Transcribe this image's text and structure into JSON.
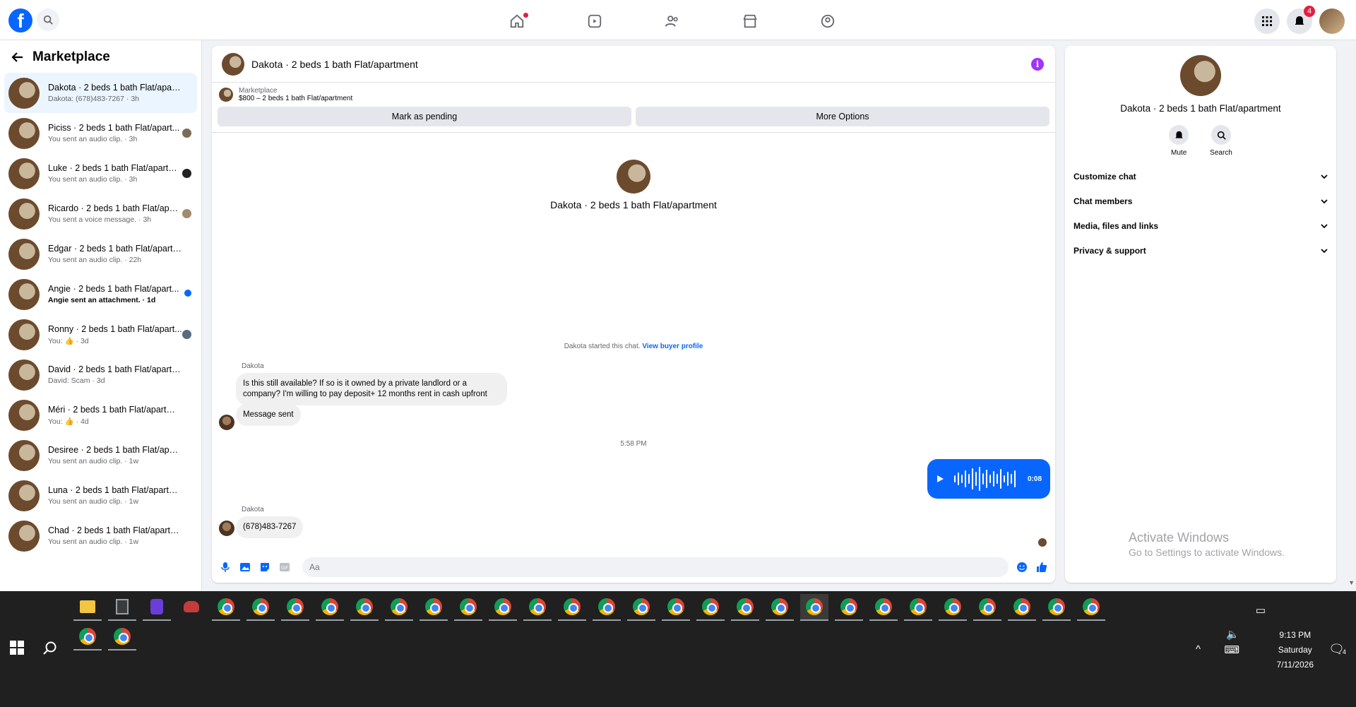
{
  "topbar": {
    "logo": "f",
    "nav": [
      "home-icon",
      "video-icon",
      "friends-icon",
      "marketplace-icon",
      "groups-icon"
    ],
    "notifications_count": "4"
  },
  "sidebar": {
    "title": "Marketplace",
    "conversations": [
      {
        "name": "Dakota · 2 beds 1 bath Flat/apartm...",
        "sub": "Dakota: (678)483-7267 · 3h",
        "active": true
      },
      {
        "name": "Piciss · 2 beds 1 bath Flat/apart...",
        "sub": "You sent an audio clip. · 3h"
      },
      {
        "name": "Luke · 2 beds 1 bath Flat/apartm...",
        "sub": "You sent an audio clip. · 3h"
      },
      {
        "name": "Ricardo · 2 beds 1 bath Flat/apar...",
        "sub": "You sent a voice message. · 3h"
      },
      {
        "name": "Edgar · 2 beds 1 bath Flat/apartment",
        "sub": "You sent an audio clip. · 22h"
      },
      {
        "name": "Angie · 2 beds 1 bath Flat/apart...",
        "sub": "Angie sent an attachment. · 1d",
        "unread": true
      },
      {
        "name": "Ronny · 2 beds 1 bath Flat/apart...",
        "sub": "You: 👍 · 3d"
      },
      {
        "name": "David · 2 beds 1 bath Flat/apartment",
        "sub": "David: Scam · 3d"
      },
      {
        "name": "Méri · 2 beds 1 bath Flat/apartment",
        "sub": "You: 👍 · 4d"
      },
      {
        "name": "Desiree · 2 beds 1 bath Flat/apart...",
        "sub": "You sent an audio clip. · 1w"
      },
      {
        "name": "Luna · 2 beds 1 bath Flat/apartment",
        "sub": "You sent an audio clip. · 1w"
      },
      {
        "name": "Chad · 2 beds 1 bath Flat/apartment",
        "sub": "You sent an audio clip. · 1w"
      }
    ]
  },
  "chat": {
    "title": "Dakota · 2 beds 1 bath Flat/apartment",
    "marketplace_label": "Marketplace",
    "listing": "$800 – 2 beds 1 bath Flat/apartment",
    "mark_pending": "Mark as pending",
    "more_options": "More Options",
    "intro_name": "Dakota · 2 beds 1 bath Flat/apartment",
    "started_text": "Dakota started this chat.",
    "view_profile": "View buyer profile",
    "sender1": "Dakota",
    "msg1": "Is this still available? If so is it owned by a private landlord or a company? I'm willing to pay deposit+ 12 months rent in cash upfront",
    "msg2": "Message sent",
    "time": "5:58 PM",
    "audio_duration": "0:08",
    "sender2": "Dakota",
    "msg3": "(678)483-7267",
    "input_placeholder": "Aa"
  },
  "info": {
    "name": "Dakota · 2 beds 1 bath Flat/apartment",
    "mute": "Mute",
    "search": "Search",
    "sections": [
      "Customize chat",
      "Chat members",
      "Media, files and links",
      "Privacy & support"
    ]
  },
  "watermark": {
    "line1": "Activate Windows",
    "line2": "Go to Settings to activate Windows."
  },
  "taskbar": {
    "time": "9:13 PM",
    "day": "Saturday",
    "date": "7/11/2026",
    "notification_count": "4"
  }
}
